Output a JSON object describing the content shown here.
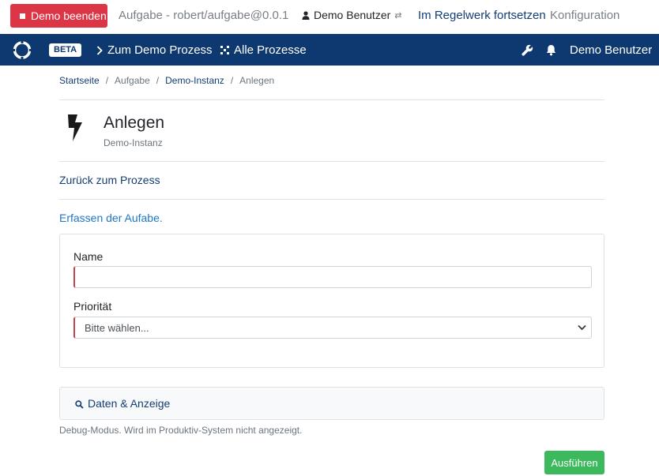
{
  "demo_bar": {
    "end_button": "Demo beenden",
    "task": "Aufgabe - robert/aufgabe@0.0.1",
    "user": "Demo Benutzer",
    "continue_link": "Im Regelwerk fortsetzen",
    "config_link": "Konfiguration"
  },
  "navbar": {
    "badge": "BETA",
    "demo_process": "Zum Demo Prozess",
    "all_processes": "Alle Prozesse",
    "user": "Demo Benutzer"
  },
  "breadcrumb": {
    "home": "Startseite",
    "task": "Aufgabe",
    "instance": "Demo-Instanz",
    "current": "Anlegen"
  },
  "header": {
    "title": "Anlegen",
    "subtitle": "Demo-Instanz"
  },
  "back_link": "Zurück zum Prozess",
  "form": {
    "intro": "Erfassen der Aufabe.",
    "name_label": "Name",
    "name_value": "",
    "priority_label": "Priorität",
    "priority_selected": "Bitte wählen..."
  },
  "data_panel": {
    "label": "Daten & Anzeige",
    "note": "Debug-Modus. Wird im Produktiv-System nicht angezeigt."
  },
  "run_button": "Ausführen",
  "colors": {
    "navbar": "#0e3870",
    "danger": "#dc3545",
    "success": "#3cb95c",
    "link": "#143d73"
  }
}
